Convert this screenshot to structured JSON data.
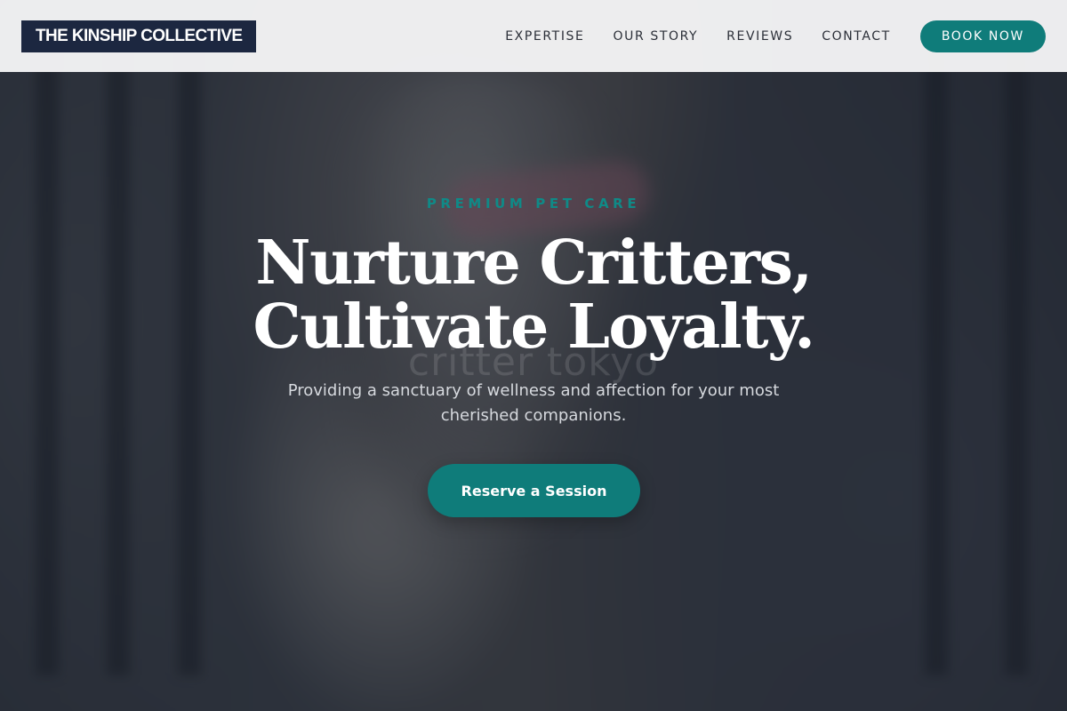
{
  "header": {
    "brand": "THE KINSHIP COLLECTIVE",
    "nav": [
      {
        "label": "EXPERTISE"
      },
      {
        "label": "OUR STORY"
      },
      {
        "label": "REVIEWS"
      },
      {
        "label": "CONTACT"
      }
    ],
    "cta_label": "BOOK NOW"
  },
  "hero": {
    "eyebrow": "PREMIUM PET CARE",
    "headline_line1": "Nurture Critters,",
    "headline_line2": "Cultivate Loyalty.",
    "watermark": "critter tokyo",
    "subtitle": "Providing a sanctuary of wellness and affection for your most cherished companions.",
    "cta_label": "Reserve a Session"
  },
  "colors": {
    "accent": "#0f7c7a",
    "brand_bg": "#1c2740",
    "header_bg": "#f5f5f6"
  }
}
